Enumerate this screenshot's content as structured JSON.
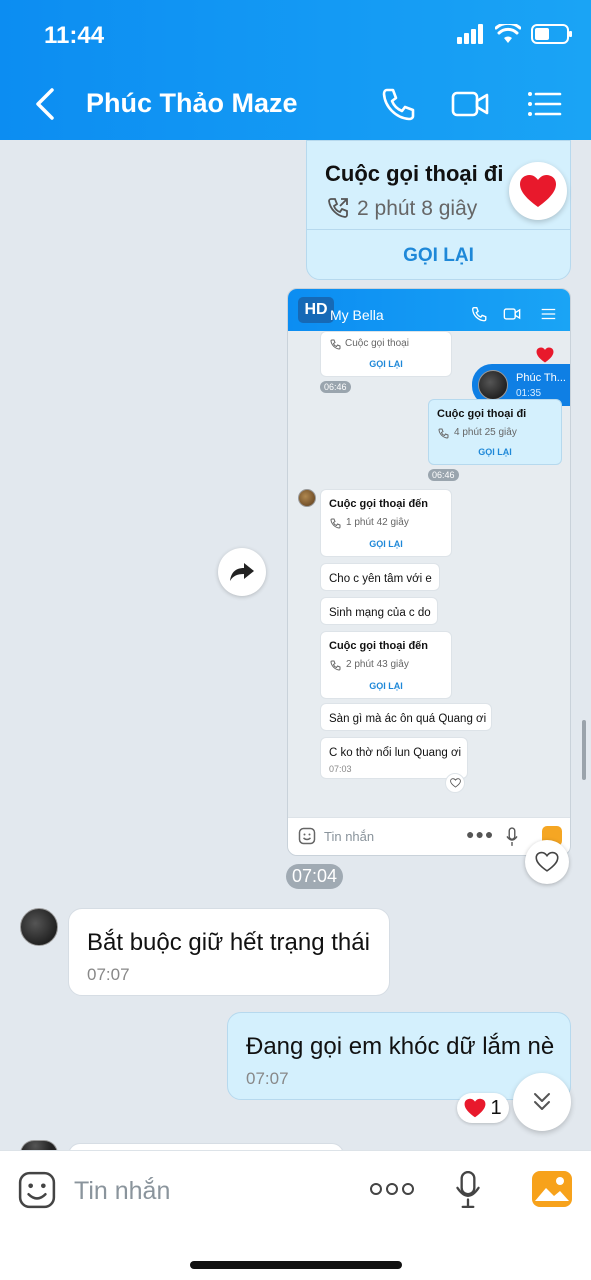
{
  "status_bar": {
    "time": "11:44"
  },
  "header": {
    "contact_name": "Phúc Thảo Maze"
  },
  "call_card": {
    "title": "Cuộc gọi thoại đi",
    "duration": "2 phút 8 giây",
    "call_again": "GỌI LẠI"
  },
  "shared_screenshot": {
    "hd_label": "HD",
    "contact_name": "My Bella",
    "msg1": {
      "title": "Cuộc gọi thoại",
      "call_again": "GỌI LẠI"
    },
    "time1": "06:46",
    "floating": {
      "name": "Phúc Th...",
      "time": "01:35"
    },
    "msg2": {
      "title": "Cuộc gọi thoại đi",
      "duration": "4 phút 25 giây",
      "call_again": "GỌI LẠI"
    },
    "time2": "06:46",
    "msg3": {
      "title": "Cuộc gọi thoại đến",
      "duration": "1 phút 42 giây",
      "call_again": "GỌI LẠI"
    },
    "msg4": "Cho c yên tâm với e",
    "msg5": "Sinh mạng của c do",
    "msg6": {
      "title": "Cuộc gọi thoại đến",
      "duration": "2 phút 43 giây",
      "call_again": "GỌI LẠI"
    },
    "msg7": "Sàn gì mà ác ôn quá Quang ơi",
    "msg8": "C ko thờ nổi lun Quang ơi",
    "time8": "07:03",
    "input_placeholder": "Tin nhắn"
  },
  "shot_time": "07:04",
  "messages": [
    {
      "text": "Bắt buộc giữ hết trạng thái",
      "time": "07:07"
    },
    {
      "text": "Đang gọi em khóc dữ lắm nè",
      "time": "07:07",
      "reaction_count": "1"
    }
  ],
  "input": {
    "placeholder": "Tin nhắn"
  },
  "colors": {
    "header": "#0c8df2",
    "accent": "#1e88d8",
    "my_bubble": "#d4f0fd",
    "heart": "#e8192c"
  }
}
